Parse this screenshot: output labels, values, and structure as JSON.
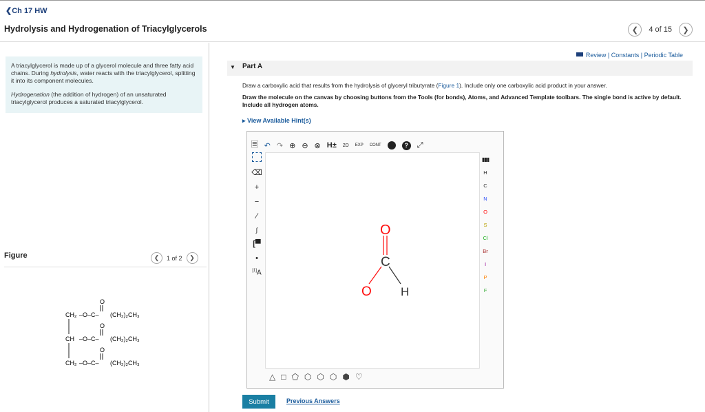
{
  "header": {
    "back_label": "Ch 17 HW",
    "title": "Hydrolysis and Hydrogenation of Triacylglycerols",
    "page_count": "4 of 15"
  },
  "intro": {
    "para1_a": "A triacylglycerol is made up of a glycerol molecule and three fatty acid chains. During ",
    "para1_em": "hydrolysis",
    "para1_b": ", water reacts with the triacylglycerol, splitting it into its component molecules.",
    "para2_em": "Hydrogenation",
    "para2_b": " (the addition of hydrogen) of an unsaturated triacylglycerol produces a saturated triacylglycerol."
  },
  "figure": {
    "label": "Figure",
    "count": "1 of 2",
    "rows": [
      {
        "left": "CH₂",
        "right": "(CH₂)₂CH₃"
      },
      {
        "left": "CH ",
        "right": "(CH₂)₂CH₃"
      },
      {
        "left": "CH₂",
        "right": "(CH₂)₂CH₃"
      }
    ]
  },
  "links": {
    "review": "Review",
    "constants": "Constants",
    "periodic": "Periodic Table",
    "sep": " | "
  },
  "part": {
    "title": "Part A",
    "instr_a": "Draw a carboxylic acid that results from the hydrolysis of glyceryl tributyrate (",
    "instr_link": "Figure 1",
    "instr_b": "). Include only one carboxylic acid product in your answer.",
    "instr_bold": "Draw the molecule on the canvas by choosing buttons from the Tools (for bonds), Atoms, and Advanced Template toolbars. The single bond is active by default. Include all hydrogen atoms.",
    "hints": "View Available Hint(s)"
  },
  "editor": {
    "top_tools": [
      "new-doc",
      "undo",
      "redo",
      "zoom-in",
      "zoom-out",
      "zoom-fit",
      "H±",
      "2D",
      "EXP",
      "CONT",
      "info",
      "help",
      "fullscreen"
    ],
    "top_labels": {
      "h_toggle": "H±",
      "two_d": "2D",
      "exp": "EXP",
      "cont": "CONT"
    },
    "left_labels": {
      "plus": "+",
      "minus": "−",
      "charge": "[1]",
      "atom_a": "A"
    },
    "atoms": [
      "H",
      "C",
      "N",
      "O",
      "S",
      "Cl",
      "Br",
      "I",
      "P",
      "F"
    ],
    "atom_colors": {
      "H": "#333",
      "C": "#333",
      "N": "#3050f8",
      "O": "#ff0d0d",
      "S": "#b8a000",
      "Cl": "#1faf1f",
      "Br": "#a62929",
      "I": "#940094",
      "P": "#ff8000",
      "F": "#3faf3f"
    },
    "molecule": {
      "atoms": [
        "O",
        "C",
        "O",
        "H"
      ],
      "bonds": [
        "C=O",
        "C-O",
        "C-H"
      ]
    }
  },
  "actions": {
    "submit": "Submit",
    "previous": "Previous Answers"
  }
}
